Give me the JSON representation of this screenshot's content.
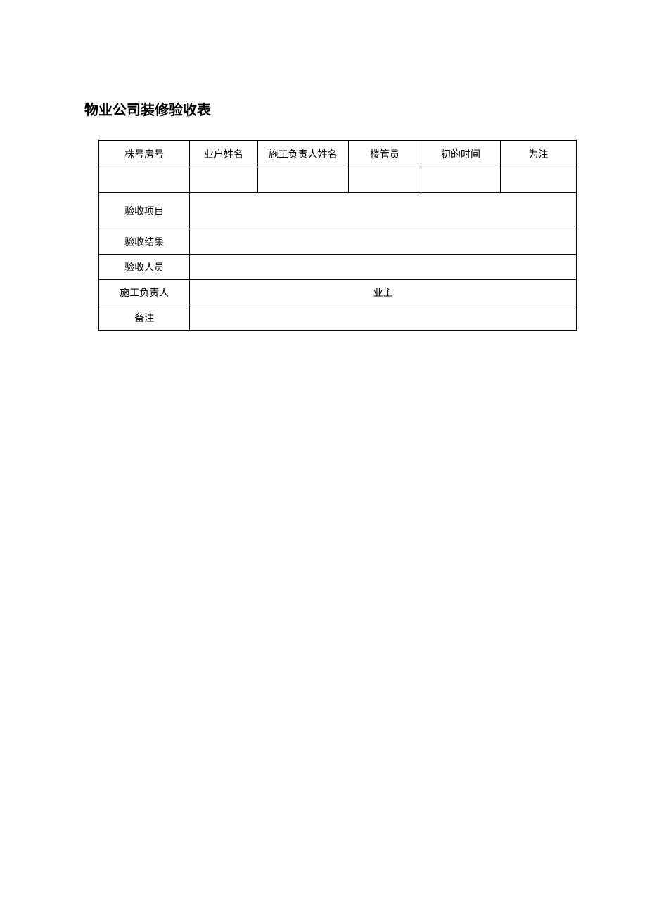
{
  "title": "物业公司装修验收表",
  "headers": {
    "building_room": "株号房号",
    "owner_name": "业户姓名",
    "construction_manager_name": "施工负责人姓名",
    "property_manager": "楼管员",
    "initial_time": "初的时间",
    "note": "为注"
  },
  "values": {
    "building_room": "",
    "owner_name": "",
    "construction_manager_name": "",
    "property_manager": "",
    "initial_time": "",
    "note": ""
  },
  "labels": {
    "inspection_project": "验收项目",
    "inspection_result": "验收结果",
    "inspection_staff": "验收人员",
    "construction_supervisor": "施工负责人",
    "owner": "业主",
    "remark": "备注"
  },
  "fields": {
    "inspection_project": "",
    "inspection_result": "",
    "inspection_staff": "",
    "construction_supervisor_value": "",
    "remark": ""
  }
}
